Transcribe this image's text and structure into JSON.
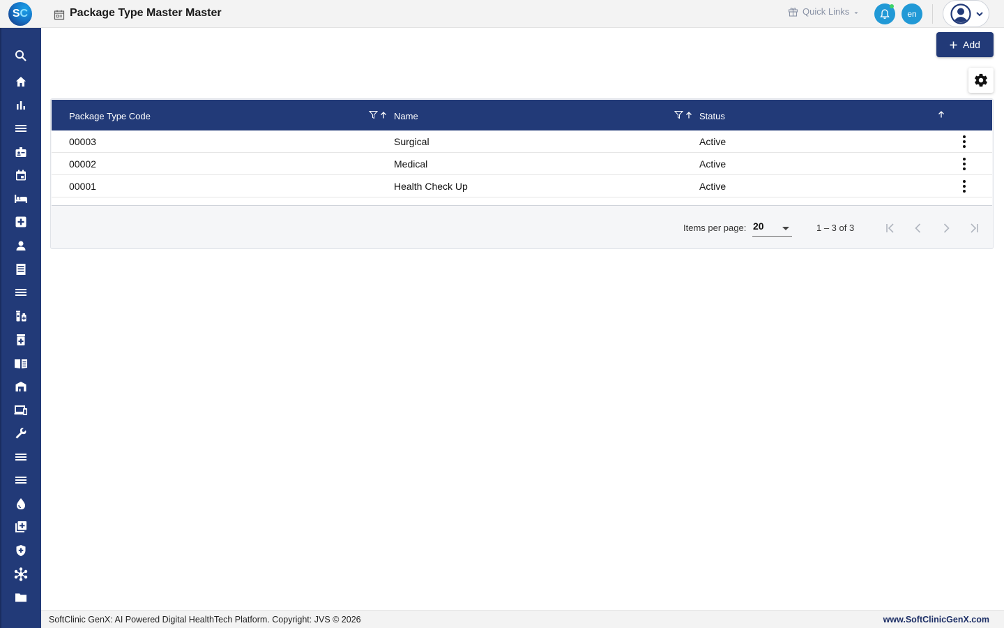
{
  "app": {
    "logo_text_s": "S",
    "logo_text_c": "C",
    "page_title": "Package Type Master Master"
  },
  "header": {
    "quick_links_label": "Quick Links",
    "language": "en"
  },
  "sidebar": {
    "items": [
      "search-icon",
      "home-icon",
      "bar-chart-icon",
      "menu-lines-icon",
      "badge-icon",
      "calendar-icon",
      "bed-icon",
      "medical-plus-icon",
      "person-icon",
      "document-list-icon",
      "menu-lines-icon",
      "medication-icon",
      "pharmacy-icon",
      "book-icon",
      "warehouse-icon",
      "devices-icon",
      "wrench-icon",
      "menu-lines-icon",
      "menu-lines-icon",
      "drop-icon",
      "library-add-icon",
      "shield-icon",
      "hub-icon",
      "folder-icon"
    ]
  },
  "toolbar": {
    "add_label": "Add"
  },
  "table": {
    "columns": [
      "Package Type Code",
      "Name",
      "Status"
    ],
    "rows": [
      {
        "code": "00003",
        "name": "Surgical",
        "status": "Active"
      },
      {
        "code": "00002",
        "name": "Medical",
        "status": "Active"
      },
      {
        "code": "00001",
        "name": "Health Check Up",
        "status": "Active"
      }
    ]
  },
  "paginator": {
    "items_per_page_label": "Items per page:",
    "items_per_page_value": "20",
    "range_label": "1 – 3 of 3"
  },
  "footer": {
    "left_text": "SoftClinic GenX: AI Powered Digital HealthTech Platform. Copyright: JVS © 2026",
    "right_text": "www.SoftClinicGenX.com"
  },
  "colors": {
    "primary": "#223a78",
    "accent": "#2199d6",
    "header_bg": "#f3f3f3"
  }
}
